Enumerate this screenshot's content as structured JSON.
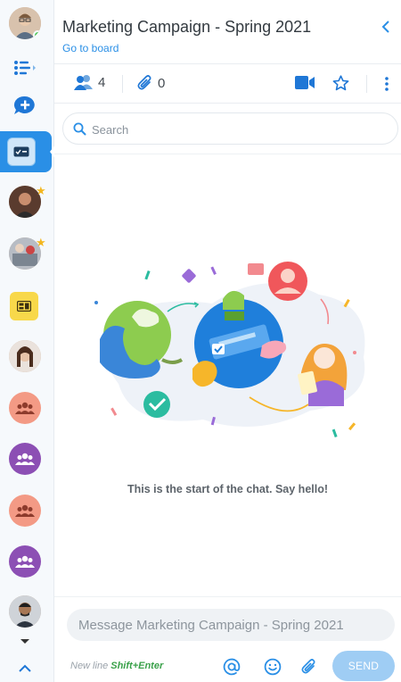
{
  "header": {
    "title": "Marketing Campaign - Spring 2021",
    "go_to_board": "Go to board"
  },
  "toolbar": {
    "members_count": "4",
    "attachments_count": "0"
  },
  "search": {
    "placeholder": "Search"
  },
  "chat": {
    "empty_message": "This is the start of the chat. Say hello!"
  },
  "composer": {
    "placeholder": "Message Marketing Campaign - Spring 2021",
    "hint_prefix": "New line",
    "hint_shortcut": "Shift+Enter",
    "send_label": "SEND"
  },
  "colors": {
    "accent": "#2a8fe6",
    "send_disabled": "#9fcdf4",
    "online": "#4cc85b",
    "favorite_star": "#f3b61f"
  },
  "icons": {
    "rail": [
      "user-avatar",
      "task-list-icon",
      "new-chat-icon",
      "board-icon",
      "contact-avatar",
      "contact-avatar",
      "board-icon",
      "contact-avatar",
      "group-icon",
      "group-icon",
      "group-icon",
      "group-icon",
      "contact-avatar",
      "chevron-up-icon"
    ],
    "toolbar": [
      "members-icon",
      "paperclip-icon",
      "video-call-icon",
      "star-icon",
      "more-vertical-icon"
    ],
    "composer": [
      "mention-icon",
      "emoji-icon",
      "paperclip-icon"
    ]
  }
}
